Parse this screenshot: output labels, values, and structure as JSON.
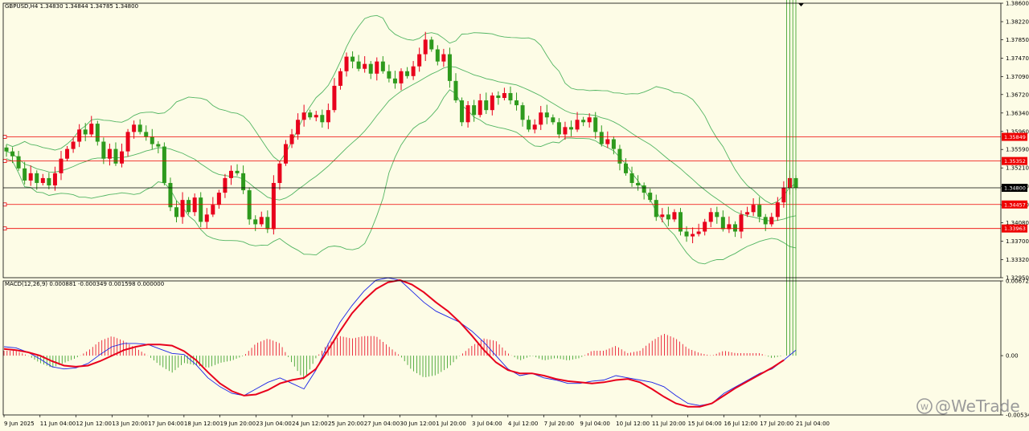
{
  "header": {
    "symbol_info": "GBPUSD,H4  1.34830 1.34844 1.34785 1.34800",
    "macd_info": "MACD(12,26,9) 0.000881 -0.000349 0.001598 0.000000"
  },
  "watermark": "@WeTrade",
  "colors": {
    "background": "#fdfce6",
    "bull": "#e8001c",
    "bear": "#2e9a1d",
    "bands": "#52b562",
    "level_line": "#ee0000",
    "current_price": "#000000",
    "macd_main": "#1a22e6",
    "macd_signal": "#e8001c"
  },
  "chart_data": [
    {
      "type": "candlestick",
      "title": "GBPUSD,H4",
      "overlay": "Bollinger Bands",
      "ylim": [
        1.3295,
        1.386
      ],
      "y_ticks": [
        "1.38600",
        "1.38220",
        "1.37850",
        "1.37470",
        "1.37090",
        "1.36720",
        "1.36340",
        "1.35960",
        "1.35590",
        "1.35210",
        "1.34830",
        "1.34450",
        "1.34080",
        "1.33700",
        "1.33320",
        "1.32950"
      ],
      "x_ticks": [
        "9 Jun 2025",
        "11 Jun 04:00",
        "12 Jun 12:00",
        "13 Jun 20:00",
        "17 Jun 04:00",
        "18 Jun 12:00",
        "19 Jun 20:00",
        "23 Jun 04:00",
        "24 Jun 12:00",
        "25 Jun 20:00",
        "27 Jun 04:00",
        "30 Jun 12:00",
        "1 Jul 20:00",
        "3 Jul 04:00",
        "4 Jul 12:00",
        "7 Jul 20:00",
        "9 Jul 04:00",
        "10 Jul 12:00",
        "11 Jul 20:00",
        "15 Jul 04:00",
        "16 Jul 12:00",
        "17 Jul 20:00",
        "21 Jul 04:00"
      ],
      "levels": [
        {
          "label": "1.35849",
          "value": 1.35849,
          "kind": "red"
        },
        {
          "label": "1.35352",
          "value": 1.35352,
          "kind": "red"
        },
        {
          "label": "1.34800",
          "value": 1.348,
          "kind": "current"
        },
        {
          "label": "1.34457",
          "value": 1.34457,
          "kind": "red"
        },
        {
          "label": "1.33963",
          "value": 1.33963,
          "kind": "red"
        }
      ],
      "closes": [
        1.3555,
        1.3545,
        1.352,
        1.3495,
        1.351,
        1.349,
        1.35,
        1.3485,
        1.351,
        1.354,
        1.356,
        1.3575,
        1.36,
        1.359,
        1.3612,
        1.3575,
        1.354,
        1.356,
        1.353,
        1.3555,
        1.3595,
        1.361,
        1.3595,
        1.3585,
        1.357,
        1.3565,
        1.349,
        1.344,
        1.342,
        1.3455,
        1.343,
        1.346,
        1.341,
        1.3425,
        1.3445,
        1.347,
        1.35,
        1.3515,
        1.351,
        1.3475,
        1.3415,
        1.3405,
        1.342,
        1.3395,
        1.349,
        1.353,
        1.357,
        1.359,
        1.362,
        1.3635,
        1.3625,
        1.363,
        1.3615,
        1.364,
        1.369,
        1.372,
        1.375,
        1.374,
        1.3725,
        1.3735,
        1.3715,
        1.374,
        1.372,
        1.3705,
        1.3695,
        1.372,
        1.371,
        1.373,
        1.3755,
        1.3785,
        1.3765,
        1.374,
        1.3755,
        1.37,
        1.366,
        1.3615,
        1.365,
        1.363,
        1.366,
        1.364,
        1.367,
        1.3665,
        1.3675,
        1.366,
        1.365,
        1.362,
        1.36,
        1.361,
        1.3635,
        1.3625,
        1.3615,
        1.359,
        1.3605,
        1.36,
        1.362,
        1.3615,
        1.3625,
        1.3595,
        1.357,
        1.358,
        1.356,
        1.353,
        1.351,
        1.349,
        1.3485,
        1.347,
        1.3455,
        1.342,
        1.3425,
        1.3415,
        1.343,
        1.339,
        1.338,
        1.3385,
        1.339,
        1.341,
        1.343,
        1.342,
        1.3395,
        1.3405,
        1.339,
        1.3425,
        1.343,
        1.3445,
        1.342,
        1.3405,
        1.342,
        1.345,
        1.348,
        1.35,
        1.348
      ]
    },
    {
      "type": "macd",
      "title": "MACD(12,26,9)",
      "ylim": [
        -0.005342,
        0.006727
      ],
      "y_ticks": [
        "0.006727",
        "0.00",
        "-0.005342"
      ],
      "main": [
        0.0008,
        0.0007,
        0.0003,
        -0.0003,
        -0.001,
        -0.0012,
        -0.0011,
        -0.0007,
        0.0001,
        0.0008,
        0.0011,
        0.0011,
        0.001,
        0.0006,
        0.0002,
        0.0001,
        -0.0008,
        -0.002,
        -0.0028,
        -0.0034,
        -0.0036,
        -0.003,
        -0.0024,
        -0.002,
        -0.0025,
        -0.003,
        -0.0013,
        0.001,
        0.003,
        0.0045,
        0.0058,
        0.0068,
        0.007,
        0.0068,
        0.0058,
        0.0048,
        0.004,
        0.0035,
        0.003,
        0.0022,
        0.0012,
        0.0,
        -0.0012,
        -0.0018,
        -0.0016,
        -0.002,
        -0.0022,
        -0.0025,
        -0.0025,
        -0.0023,
        -0.0022,
        -0.0018,
        -0.002,
        -0.0022,
        -0.0024,
        -0.0028,
        -0.0036,
        -0.0043,
        -0.0045,
        -0.0043,
        -0.0034,
        -0.0028,
        -0.0022,
        -0.0016,
        -0.0012,
        -0.0004,
        0.0005
      ],
      "signal": [
        0.0006,
        0.0005,
        0.0003,
        0.0,
        -0.0005,
        -0.0009,
        -0.001,
        -0.0009,
        -0.0005,
        0.0,
        0.0005,
        0.0008,
        0.001,
        0.001,
        0.0009,
        0.0004,
        -0.0004,
        -0.0015,
        -0.0025,
        -0.0032,
        -0.0036,
        -0.0035,
        -0.0031,
        -0.0025,
        -0.0022,
        -0.002,
        -0.0012,
        0.0005,
        0.0022,
        0.0038,
        0.005,
        0.006,
        0.0066,
        0.0068,
        0.0064,
        0.0057,
        0.0048,
        0.004,
        0.003,
        0.0018,
        0.0005,
        -0.0006,
        -0.0013,
        -0.0016,
        -0.0016,
        -0.0018,
        -0.0021,
        -0.0023,
        -0.0024,
        -0.0025,
        -0.0024,
        -0.0022,
        -0.0021,
        -0.0024,
        -0.003,
        -0.0037,
        -0.0043,
        -0.0046,
        -0.0046,
        -0.0043,
        -0.0036,
        -0.0029,
        -0.0023,
        -0.0017,
        -0.0011,
        -0.0004
      ]
    }
  ]
}
